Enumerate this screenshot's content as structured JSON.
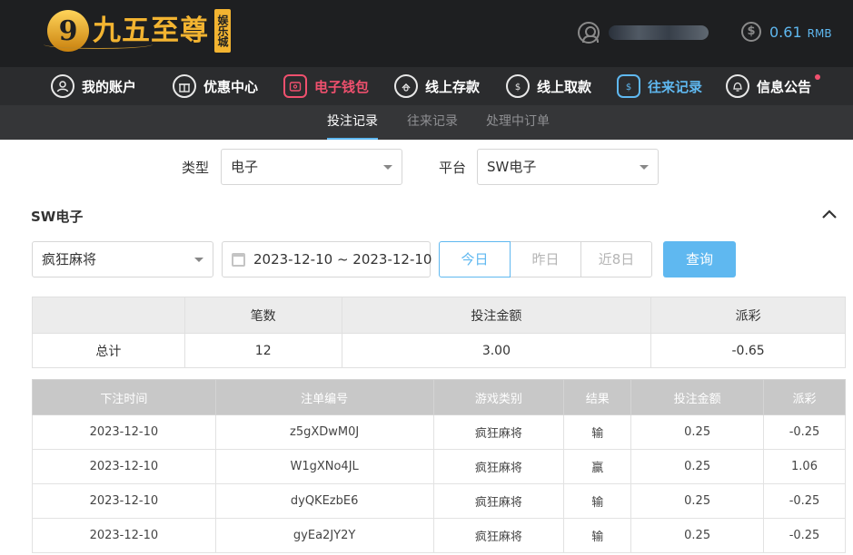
{
  "brand": {
    "logo_char": "9",
    "name": "九五至尊",
    "badge": "娱乐城"
  },
  "account": {
    "balance": "0.61",
    "currency": "RMB"
  },
  "nav": [
    {
      "label": "我的账户",
      "icon": "user-circle-icon"
    },
    {
      "label": "优惠中心",
      "icon": "gift-icon"
    },
    {
      "label": "电子钱包",
      "icon": "wallet-icon"
    },
    {
      "label": "线上存款",
      "icon": "deposit-icon"
    },
    {
      "label": "线上取款",
      "icon": "withdraw-icon"
    },
    {
      "label": "往来记录",
      "icon": "records-icon"
    },
    {
      "label": "信息公告",
      "icon": "bell-icon"
    }
  ],
  "subtabs": [
    "投注记录",
    "往来记录",
    "处理中订单"
  ],
  "filters": {
    "type_label": "类型",
    "type_value": "电子",
    "platform_label": "平台",
    "platform_value": "SW电子"
  },
  "section": {
    "title": "SW电子",
    "game_value": "疯狂麻将",
    "date_range": "2023-12-10 ~ 2023-12-10",
    "quick": [
      "今日",
      "昨日",
      "近8日"
    ],
    "query_label": "查询"
  },
  "summary": {
    "headers": [
      "",
      "笔数",
      "投注金额",
      "派彩"
    ],
    "row": {
      "label": "总计",
      "count": "12",
      "bet": "3.00",
      "payout": "-0.65"
    }
  },
  "detail": {
    "headers": [
      "下注时间",
      "注单编号",
      "游戏类别",
      "结果",
      "投注金额",
      "派彩"
    ],
    "rows": [
      {
        "time": "2023-12-10",
        "id": "z5gXDwM0J",
        "game": "疯狂麻将",
        "result": "输",
        "bet": "0.25",
        "payout": "-0.25"
      },
      {
        "time": "2023-12-10",
        "id": "W1gXNo4JL",
        "game": "疯狂麻将",
        "result": "赢",
        "bet": "0.25",
        "payout": "1.06"
      },
      {
        "time": "2023-12-10",
        "id": "dyQKEzbE6",
        "game": "疯狂麻将",
        "result": "输",
        "bet": "0.25",
        "payout": "-0.25"
      },
      {
        "time": "2023-12-10",
        "id": "gyEa2JY2Y",
        "game": "疯狂麻将",
        "result": "输",
        "bet": "0.25",
        "payout": "-0.25"
      }
    ]
  },
  "colors": {
    "accent": "#5fb8f0",
    "wallet": "#f0506e",
    "negative": "#e0474c",
    "header_bg": "#1e1f21"
  }
}
